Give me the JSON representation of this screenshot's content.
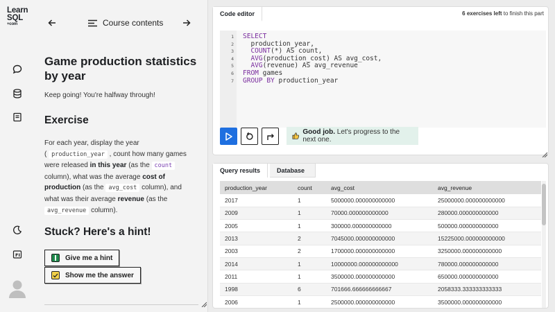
{
  "rail": {
    "logo_line1": "Learn",
    "logo_line2": "SQL",
    "logo_line3": "+com",
    "icons": [
      "chat-icon",
      "database-icon",
      "notes-icon",
      "moon-icon",
      "fi-icon",
      "avatar"
    ]
  },
  "lesson_nav": {
    "title": "Course contents"
  },
  "lesson": {
    "heading": "Game production statistics by year",
    "subtext": "Keep going! You're halfway through!",
    "exercise_heading": "Exercise",
    "exercise": {
      "t1": "For each year, display the year",
      "t2": "(",
      "c1": "production_year",
      "t3": ", count how many games were released",
      "b1": "in this year",
      "t4": "(as the",
      "c2": "count",
      "t5": "column), what was the average",
      "b2": "cost of production",
      "t6": "(as the",
      "c3": "avg_cost",
      "t7": "column), and what was their average",
      "b3": "revenue",
      "t8": "(as the",
      "c4": "avg_revenue",
      "t9": "column)."
    },
    "hint_heading": "Stuck? Here's a hint!",
    "hint_button": "Give me a hint",
    "answer_button": "Show me the answer"
  },
  "editor": {
    "tab_label": "Code editor",
    "exercises_left_count": "6 exercises left",
    "exercises_left_suffix": " to finish this part",
    "line_numbers": [
      "1",
      "2",
      "3",
      "4",
      "5",
      "6",
      "7"
    ],
    "lines": [
      {
        "kw": "SELECT",
        "rest": ""
      },
      {
        "kw": "",
        "rest": "  production_year,"
      },
      {
        "kw": "  COUNT",
        "rest": "(*) AS count,"
      },
      {
        "kw": "  AVG",
        "rest": "(production_cost) AS avg_cost,"
      },
      {
        "kw": "  AVG",
        "rest": "(revenue) AS avg_revenue"
      },
      {
        "kw": "FROM",
        "rest": " games"
      },
      {
        "kw": "GROUP BY",
        "rest": " production_year"
      }
    ],
    "feedback_bold": "Good job.",
    "feedback_text": " Let's progress to the next one."
  },
  "results": {
    "tab_active": "Query results",
    "tab_inactive": "Database",
    "columns": [
      "production_year",
      "count",
      "avg_cost",
      "avg_revenue"
    ],
    "rows": [
      [
        "2017",
        "1",
        "5000000.000000000000",
        "25000000.000000000000"
      ],
      [
        "2009",
        "1",
        "70000.000000000000",
        "280000.000000000000"
      ],
      [
        "2005",
        "1",
        "300000.000000000000",
        "500000.000000000000"
      ],
      [
        "2013",
        "2",
        "7045000.000000000000",
        "15225000.000000000000"
      ],
      [
        "2003",
        "2",
        "1700000.000000000000",
        "3250000.000000000000"
      ],
      [
        "2014",
        "1",
        "10000000.000000000000",
        "780000.000000000000"
      ],
      [
        "2011",
        "1",
        "3500000.000000000000",
        "650000.000000000000"
      ],
      [
        "1998",
        "6",
        "701666.666666666667",
        "2058333.333333333333"
      ],
      [
        "2006",
        "1",
        "2500000.000000000000",
        "3500000.000000000000"
      ]
    ]
  },
  "colors": {
    "accent_blue": "#1e6fe0",
    "success_bg": "#e2f1eb",
    "keyword_purple": "#7a2d9e"
  }
}
